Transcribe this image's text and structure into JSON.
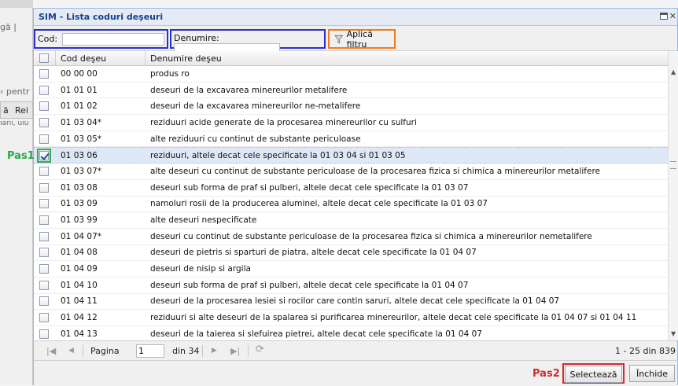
{
  "background": {
    "frag_top": "gă |",
    "frag_mid": "‹ pentr",
    "btn_a": "ă",
    "btn_b": "Rei",
    "frag_low": "ıarıı, uıu"
  },
  "window": {
    "title": "SIM - Lista coduri deşeuri"
  },
  "filter": {
    "code_label": "Cod:",
    "code_value": "",
    "name_label": "Denumire:",
    "name_value": "",
    "apply_label": "Aplică filtru"
  },
  "grid": {
    "headers": {
      "code": "Cod deşeu",
      "desc": "Denumire deşeu"
    },
    "rows": [
      {
        "code": "00 00 00",
        "desc": "produs ro",
        "checked": false
      },
      {
        "code": "01 01 01",
        "desc": "deseuri de la excavarea minereurilor metalifere",
        "checked": false
      },
      {
        "code": "01 01 02",
        "desc": "deseuri de la excavarea minereurilor ne-metalifere",
        "checked": false
      },
      {
        "code": "01 03 04*",
        "desc": "reziduuri acide generate de la procesarea minereurilor cu sulfuri",
        "checked": false
      },
      {
        "code": "01 03 05*",
        "desc": "alte reziduuri cu continut de substante periculoase",
        "checked": false
      },
      {
        "code": "01 03 06",
        "desc": "reziduuri, altele decat cele specificate la 01 03 04 si 01 03 05",
        "checked": true
      },
      {
        "code": "01 03 07*",
        "desc": "alte deseuri cu continut de substante periculoase de la procesarea fizica si chimica a minereurilor metalifere",
        "checked": false
      },
      {
        "code": "01 03 08",
        "desc": "deseuri sub forma de praf si pulberi, altele decat cele specificate la 01 03 07",
        "checked": false
      },
      {
        "code": "01 03 09",
        "desc": "namoluri rosii de la producerea aluminei, altele decat cele specificate la 01 03 07",
        "checked": false
      },
      {
        "code": "01 03 99",
        "desc": "alte deseuri nespecificate",
        "checked": false
      },
      {
        "code": "01 04 07*",
        "desc": "deseuri cu continut de substante periculoase de la procesarea fizica si chimica a minereurilor nemetalifere",
        "checked": false
      },
      {
        "code": "01 04 08",
        "desc": "deseuri de pietris si sparturi de piatra, altele decat cele specificate la 01 04 07",
        "checked": false
      },
      {
        "code": "01 04 09",
        "desc": "deseuri de nisip si argila",
        "checked": false
      },
      {
        "code": "01 04 10",
        "desc": "deseuri sub forma de praf si pulberi, altele decat cele specificate la 01 04 07",
        "checked": false
      },
      {
        "code": "01 04 11",
        "desc": "deseuri de la procesarea lesiei si rocilor care contin saruri, altele decat cele specificate la 01 04 07",
        "checked": false
      },
      {
        "code": "01 04 12",
        "desc": "reziduuri si alte deseuri de la spalarea si purificarea minereurilor, altele decat cele specificate la 01 04 07 si 01 04 11",
        "checked": false
      },
      {
        "code": "01 04 13",
        "desc": "deseuri de la taierea si slefuirea pietrei, altele decat cele specificate la 01 04 07",
        "checked": false
      }
    ]
  },
  "annotations": {
    "step1": "Pas1",
    "step2": "Pas2"
  },
  "paging": {
    "page_label": "Pagina",
    "page_value": "1",
    "of_label": "din 34",
    "info": "1 - 25 din 839"
  },
  "buttons": {
    "select": "Selectează",
    "close": "Închide"
  },
  "icons": {
    "filter": "filter-funnel-icon",
    "first": "first-page-icon",
    "prev": "prev-page-icon",
    "next": "next-page-icon",
    "last": "last-page-icon",
    "refresh": "refresh-icon"
  },
  "colors": {
    "step1": "#27a844",
    "step2": "#d42a2a",
    "filter_highlight": "#2a2fd1",
    "apply_highlight": "#f27b1c",
    "selected_row": "#dfe8f6"
  }
}
